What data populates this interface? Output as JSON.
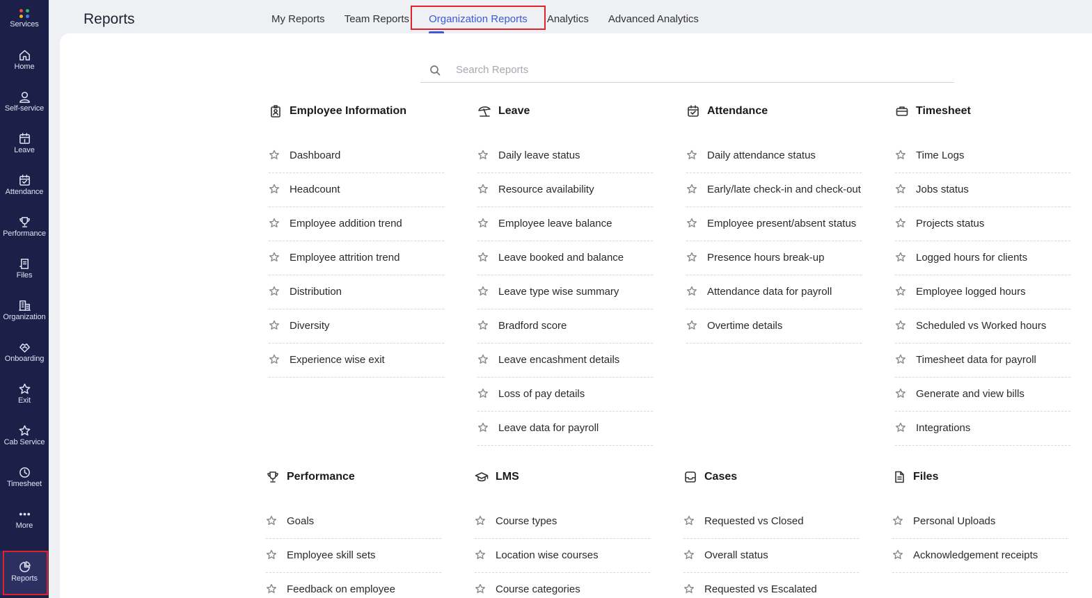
{
  "sidebar": {
    "items": [
      {
        "label": "Services",
        "icon": "services-icon"
      },
      {
        "label": "Home",
        "icon": "home-icon"
      },
      {
        "label": "Self-service",
        "icon": "user-icon"
      },
      {
        "label": "Leave",
        "icon": "calendar-leave-icon"
      },
      {
        "label": "Attendance",
        "icon": "calendar-check-icon"
      },
      {
        "label": "Performance",
        "icon": "trophy-icon"
      },
      {
        "label": "Files",
        "icon": "files-icon"
      },
      {
        "label": "Organization",
        "icon": "building-icon"
      },
      {
        "label": "Onboarding",
        "icon": "handshake-icon"
      },
      {
        "label": "Exit",
        "icon": "star-icon"
      },
      {
        "label": "Cab Service",
        "icon": "star-icon"
      },
      {
        "label": "Timesheet",
        "icon": "clock-icon"
      },
      {
        "label": "More",
        "icon": "more-icon"
      },
      {
        "label": "Reports",
        "icon": "pie-chart-icon",
        "active": true
      }
    ]
  },
  "header": {
    "title": "Reports",
    "tabs": [
      "My Reports",
      "Team Reports",
      "Organization Reports",
      "Analytics",
      "Advanced Analytics"
    ],
    "active_tab": "Organization Reports"
  },
  "search": {
    "placeholder": "Search Reports"
  },
  "groups": [
    {
      "title": "Employee Information",
      "icon": "id-badge-icon",
      "items": [
        "Dashboard",
        "Headcount",
        "Employee addition trend",
        "Employee attrition trend",
        "Distribution",
        "Diversity",
        "Experience wise exit"
      ]
    },
    {
      "title": "Leave",
      "icon": "beach-umbrella-icon",
      "items": [
        "Daily leave status",
        "Resource availability",
        "Employee leave balance",
        "Leave booked and balance",
        "Leave type wise summary",
        "Bradford score",
        "Leave encashment details",
        "Loss of pay details",
        "Leave data for payroll"
      ]
    },
    {
      "title": "Attendance",
      "icon": "calendar-check-icon",
      "items": [
        "Daily attendance status",
        "Early/late check-in and check-out",
        "Employee present/absent status",
        "Presence hours break-up",
        "Attendance data for payroll",
        "Overtime details"
      ]
    },
    {
      "title": "Timesheet",
      "icon": "briefcase-icon",
      "items": [
        "Time Logs",
        "Jobs status",
        "Projects status",
        "Logged hours for clients",
        "Employee logged hours",
        "Scheduled vs Worked hours",
        "Timesheet data for payroll",
        "Generate and view bills",
        "Integrations"
      ]
    },
    {
      "title": "Performance",
      "icon": "trophy-icon",
      "items": [
        "Goals",
        "Employee skill sets",
        "Feedback on employee"
      ]
    },
    {
      "title": "LMS",
      "icon": "graduation-cap-icon",
      "items": [
        "Course types",
        "Location wise courses",
        "Course categories"
      ]
    },
    {
      "title": "Cases",
      "icon": "inbox-icon",
      "items": [
        "Requested vs Closed",
        "Overall status",
        "Requested vs Escalated"
      ]
    },
    {
      "title": "Files",
      "icon": "file-icon",
      "items": [
        "Personal Uploads",
        "Acknowledgement receipts"
      ]
    }
  ],
  "colors": {
    "sidebar_bg": "#1c1f47",
    "accent": "#3c5ad4",
    "highlight_border": "#e0232b",
    "page_bg": "#eef0f4"
  }
}
